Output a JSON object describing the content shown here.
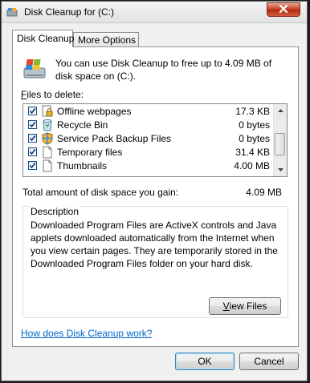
{
  "window": {
    "title": "Disk Cleanup for  (C:)"
  },
  "tabs": [
    {
      "label": "Disk Cleanup",
      "active": true
    },
    {
      "label": "More Options",
      "active": false
    }
  ],
  "intro_text": "You can use Disk Cleanup to free up to 4.09 MB of disk space on  (C:).",
  "files": {
    "label_prefix": "F",
    "label_rest": "iles to delete:",
    "items": [
      {
        "name": "Offline webpages",
        "size": "17.3 KB",
        "checked": true,
        "icon": "lock-page-icon"
      },
      {
        "name": "Recycle Bin",
        "size": "0 bytes",
        "checked": true,
        "icon": "recycle-bin-icon"
      },
      {
        "name": "Service Pack Backup Files",
        "size": "0 bytes",
        "checked": true,
        "icon": "shield-icon"
      },
      {
        "name": "Temporary files",
        "size": "31.4 KB",
        "checked": true,
        "icon": "file-icon"
      },
      {
        "name": "Thumbnails",
        "size": "4.00 MB",
        "checked": true,
        "icon": "file-icon"
      }
    ]
  },
  "total": {
    "label": "Total amount of disk space you gain:",
    "value": "4.09 MB"
  },
  "description": {
    "legend": "Description",
    "text": "Downloaded Program Files are ActiveX controls and Java applets downloaded automatically from the Internet when you view certain pages. They are temporarily stored in the Downloaded Program Files folder on your hard disk."
  },
  "buttons": {
    "view_files_prefix": "V",
    "view_files_rest": "iew Files",
    "ok": "OK",
    "cancel": "Cancel"
  },
  "help_link": "How does Disk Cleanup work?",
  "colors": {
    "link": "#0066cc",
    "close_button": "#c9452a"
  }
}
